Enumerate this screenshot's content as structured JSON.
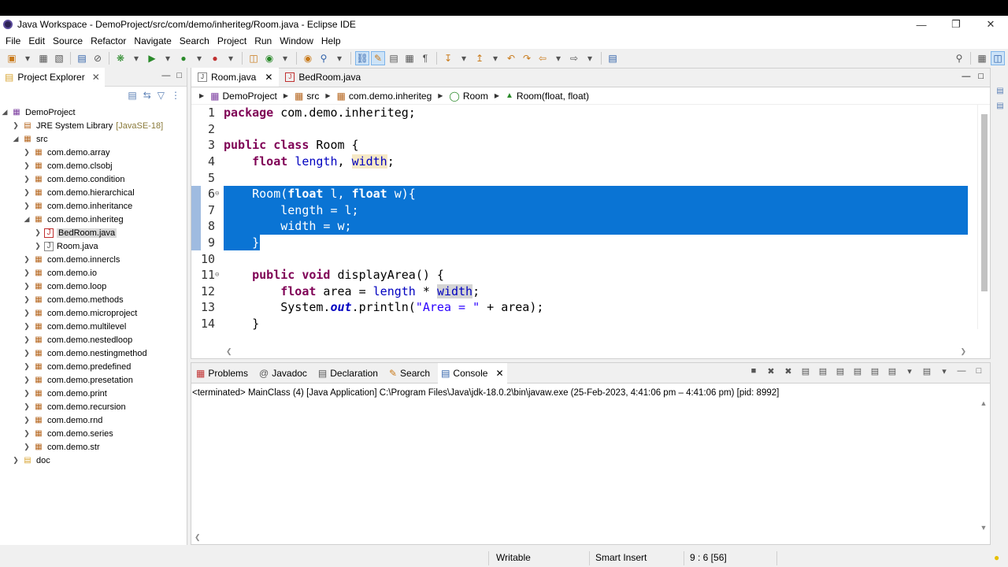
{
  "window": {
    "title": "Java Workspace - DemoProject/src/com/demo/inheriteg/Room.java - Eclipse IDE"
  },
  "menu": [
    "File",
    "Edit",
    "Source",
    "Refactor",
    "Navigate",
    "Search",
    "Project",
    "Run",
    "Window",
    "Help"
  ],
  "explorer": {
    "title": "Project Explorer",
    "project": "DemoProject",
    "jre": "JRE System Library",
    "jre_version": "[JavaSE-18]",
    "src": "src",
    "packages_before": [
      "com.demo.array",
      "com.demo.clsobj",
      "com.demo.condition",
      "com.demo.hierarchical",
      "com.demo.inheritance"
    ],
    "open_package": "com.demo.inheriteg",
    "files": [
      "BedRoom.java",
      "Room.java"
    ],
    "packages_after": [
      "com.demo.innercls",
      "com.demo.io",
      "com.demo.loop",
      "com.demo.methods",
      "com.demo.microproject",
      "com.demo.multilevel",
      "com.demo.nestedloop",
      "com.demo.nestingmethod",
      "com.demo.predefined",
      "com.demo.presetation",
      "com.demo.print",
      "com.demo.recursion",
      "com.demo.rnd",
      "com.demo.series",
      "com.demo.str"
    ],
    "doc": "doc"
  },
  "editor": {
    "tabs": [
      "Room.java",
      "BedRoom.java"
    ],
    "breadcrumb": [
      "DemoProject",
      "src",
      "com.demo.inheriteg",
      "Room",
      "Room(float, float)"
    ],
    "line_numbers": [
      "1",
      "2",
      "3",
      "4",
      "5",
      "6",
      "7",
      "8",
      "9",
      "10",
      "11",
      "12",
      "13",
      "14"
    ]
  },
  "bottom": {
    "tabs": [
      "Problems",
      "Javadoc",
      "Declaration",
      "Search",
      "Console"
    ],
    "console_text": "<terminated> MainClass (4) [Java Application] C:\\Program Files\\Java\\jdk-18.0.2\\bin\\javaw.exe  (25-Feb-2023, 4:41:06 pm – 4:41:06 pm) [pid: 8992]"
  },
  "status": {
    "mode": "Writable",
    "insert": "Smart Insert",
    "position": "9 : 6 [56]"
  }
}
